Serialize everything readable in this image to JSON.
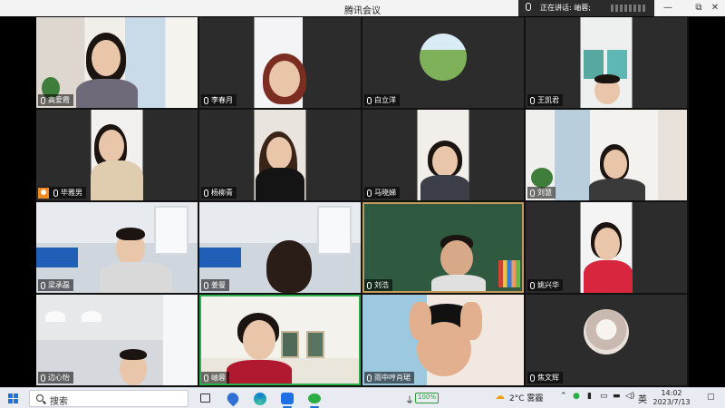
{
  "window": {
    "title": "腾讯会议",
    "speaking_label": "正在讲话: 岫蓉;",
    "minimize": "—",
    "restore": "⧉",
    "close": "✕"
  },
  "participants": [
    {
      "name": "高爱霞",
      "mic": "on"
    },
    {
      "name": "李春月",
      "mic": "on"
    },
    {
      "name": "白立洋",
      "mic": "on"
    },
    {
      "name": "王凯君",
      "mic": "on"
    },
    {
      "name": "毕雅男",
      "mic": "on",
      "host": true
    },
    {
      "name": "杨柳青",
      "mic": "on"
    },
    {
      "name": "马晓娣",
      "mic": "on"
    },
    {
      "name": "刘慧",
      "mic": "on"
    },
    {
      "name": "梁承磊",
      "mic": "on"
    },
    {
      "name": "姜曼",
      "mic": "on"
    },
    {
      "name": "刘浩",
      "mic": "on"
    },
    {
      "name": "姚兴华",
      "mic": "on"
    },
    {
      "name": "边心怡",
      "mic": "on"
    },
    {
      "name": "岫蓉",
      "mic": "on",
      "speaking": true
    },
    {
      "name": "雨中哼肖珺",
      "mic": "on"
    },
    {
      "name": "焦文辉",
      "mic": "on"
    }
  ],
  "taskbar": {
    "search_label": "搜索",
    "battery": "100%",
    "weather": "2°C 雾霾",
    "ime": "英",
    "time": "14:02",
    "date": "2023/7/13"
  }
}
